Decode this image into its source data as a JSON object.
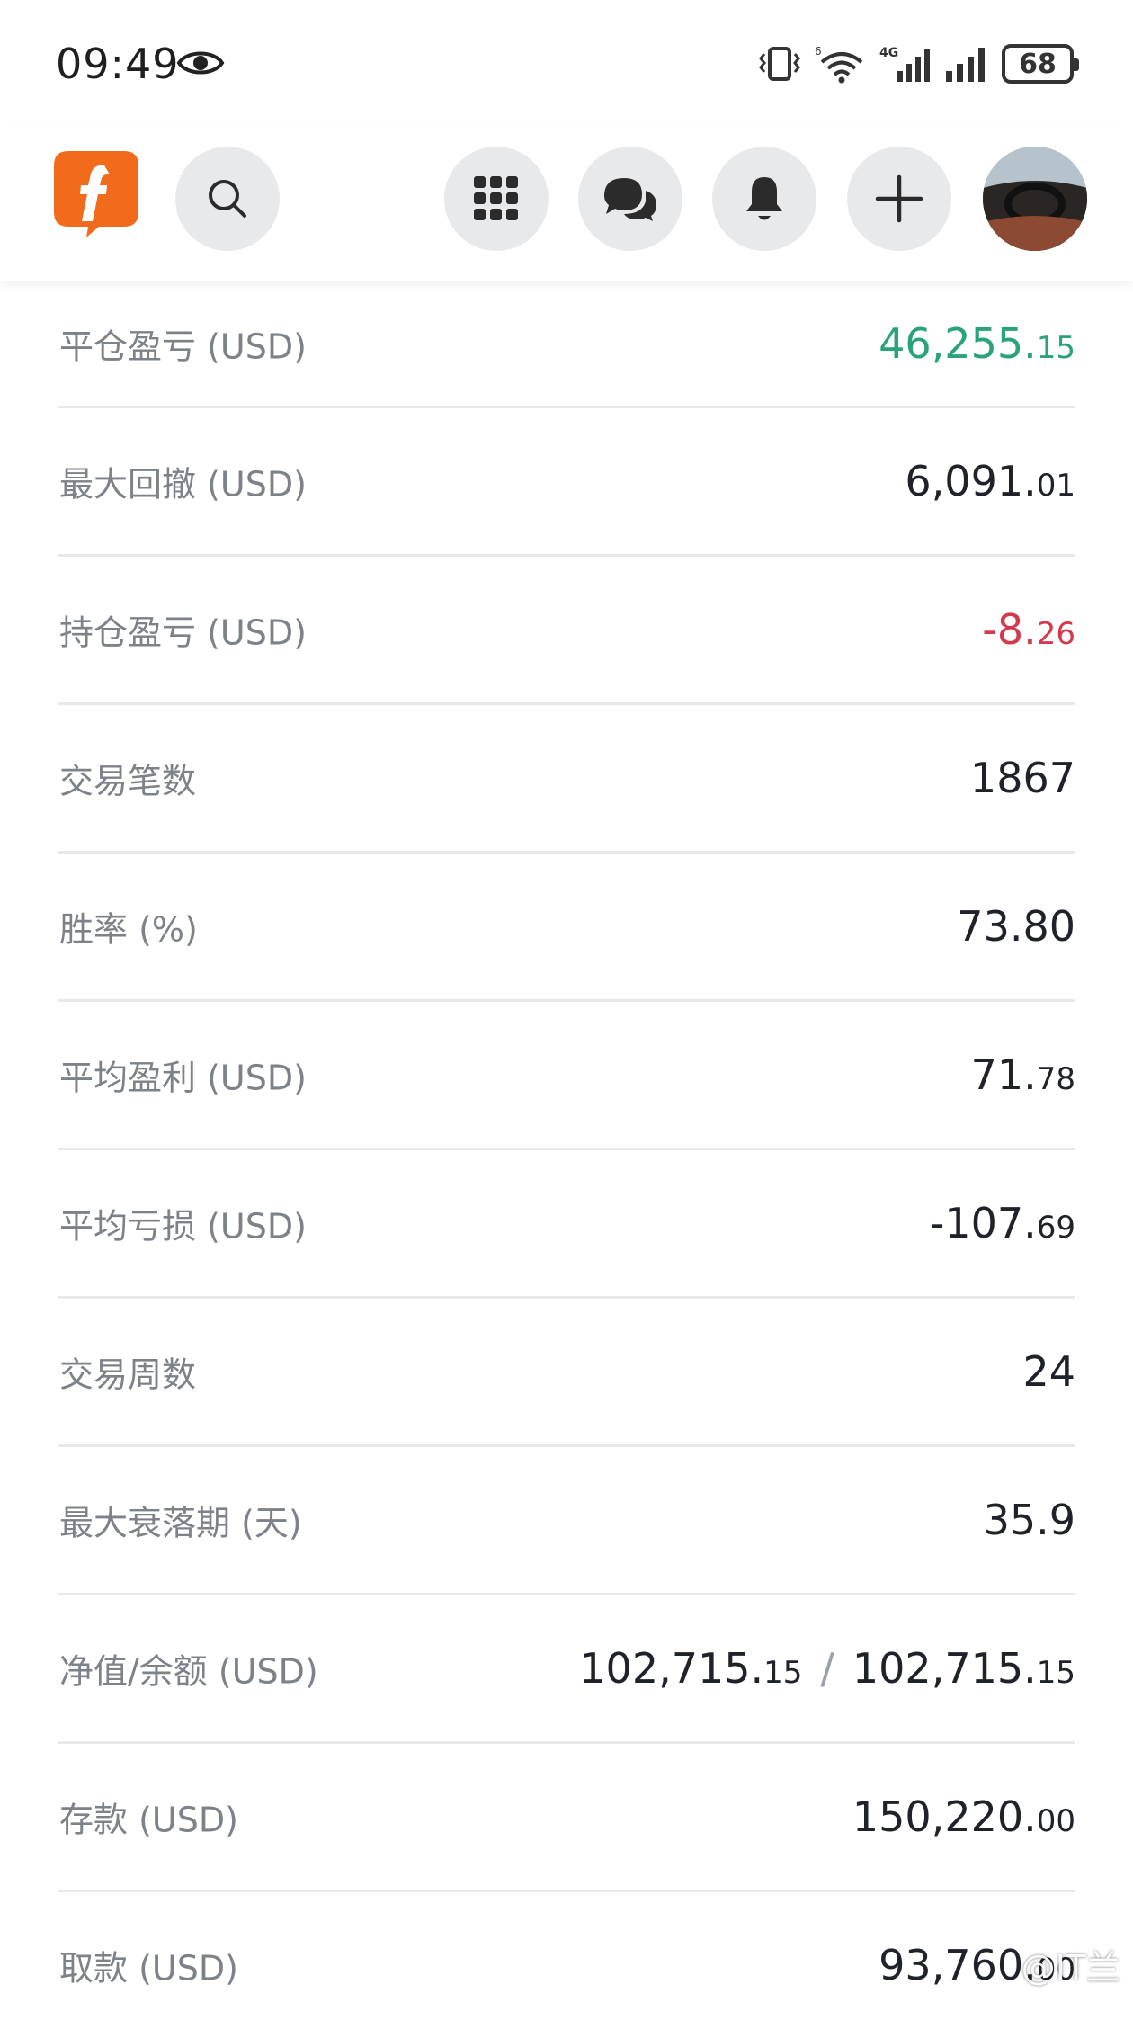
{
  "status_bar": {
    "time": "09:49",
    "battery": "68",
    "icons": [
      "eye-icon",
      "vibrate-icon",
      "wifi-6-icon",
      "signal-4g-icon",
      "signal-icon",
      "battery-icon"
    ]
  },
  "header": {
    "logo": "f",
    "buttons": [
      "search-icon",
      "apps-grid-icon",
      "chat-icon",
      "bell-icon",
      "plus-icon"
    ],
    "avatar": "user-avatar"
  },
  "colors": {
    "positive": "#2aa27e",
    "negative": "#d33a4f",
    "brand": "#f26b1d"
  },
  "rows": [
    {
      "label": "平仓盈亏 (USD)",
      "int": "46,255.",
      "dec": "15"
    },
    {
      "label": "最大回撤 (USD)",
      "int": "6,091.",
      "dec": "01"
    },
    {
      "label": "持仓盈亏 (USD)",
      "int": "-8.",
      "dec": "26"
    },
    {
      "label": "交易笔数",
      "int": "1867",
      "dec": ""
    },
    {
      "label": "胜率 (%)",
      "int": "73.80",
      "dec": ""
    },
    {
      "label": "平均盈利 (USD)",
      "int": "71.",
      "dec": "78"
    },
    {
      "label": "平均亏损 (USD)",
      "int": "-107.",
      "dec": "69"
    },
    {
      "label": "交易周数",
      "int": "24",
      "dec": ""
    },
    {
      "label": "最大衰落期 (天)",
      "int": "35.9",
      "dec": ""
    },
    {
      "label": "净值/余额 (USD)",
      "int": "102,715.",
      "dec": "15",
      "sep": "/",
      "int2": "102,715.",
      "dec2": "15"
    },
    {
      "label": "存款 (USD)",
      "int": "150,220.",
      "dec": "00"
    },
    {
      "label": "取款 (USD)",
      "int": "93,760.",
      "dec": "00"
    }
  ],
  "watermark": "@IT兰"
}
